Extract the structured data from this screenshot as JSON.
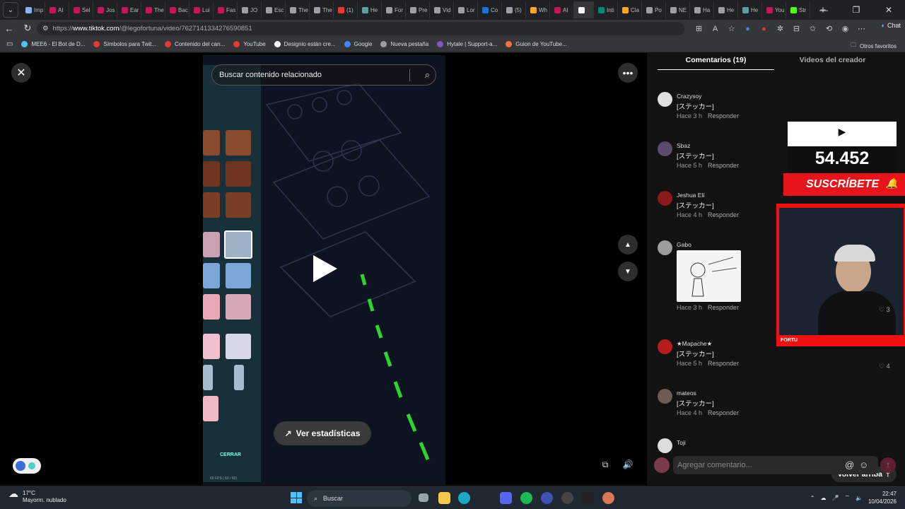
{
  "browser": {
    "tabs": [
      {
        "label": "Imp",
        "color": "#8ab4f8"
      },
      {
        "label": "AI",
        "color": "#c2185b"
      },
      {
        "label": "Sel",
        "color": "#c2185b"
      },
      {
        "label": "Jos",
        "color": "#c2185b"
      },
      {
        "label": "Ear",
        "color": "#c2185b"
      },
      {
        "label": "The",
        "color": "#c2185b"
      },
      {
        "label": "Bac",
        "color": "#c2185b"
      },
      {
        "label": "Lui",
        "color": "#c2185b"
      },
      {
        "label": "Fas",
        "color": "#c2185b"
      },
      {
        "label": "JO",
        "color": "#9aa0a6"
      },
      {
        "label": "Esc",
        "color": "#9aa0a6"
      },
      {
        "label": "The",
        "color": "#9aa0a6"
      },
      {
        "label": "The",
        "color": "#9aa0a6"
      },
      {
        "label": "(1)",
        "color": "#e53935"
      },
      {
        "label": "He",
        "color": "#5f9ea0"
      },
      {
        "label": "For",
        "color": "#9aa0a6"
      },
      {
        "label": "Pre",
        "color": "#9aa0a6"
      },
      {
        "label": "Vid",
        "color": "#9aa0a6"
      },
      {
        "label": "Lor",
        "color": "#9aa0a6"
      },
      {
        "label": "Co",
        "color": "#1976d2"
      },
      {
        "label": "(5)",
        "color": "#9aa0a6"
      },
      {
        "label": "Wh",
        "color": "#f9a825"
      },
      {
        "label": "AI",
        "color": "#c2185b"
      },
      {
        "label": "",
        "color": "#ffffff"
      },
      {
        "label": "Inti",
        "color": "#00897b"
      },
      {
        "label": "Cla",
        "color": "#f9a825"
      },
      {
        "label": "Po",
        "color": "#9aa0a6"
      },
      {
        "label": "NE",
        "color": "#9aa0a6"
      },
      {
        "label": "Ha",
        "color": "#9aa0a6"
      },
      {
        "label": "He",
        "color": "#9aa0a6"
      },
      {
        "label": "He",
        "color": "#5f9ea0"
      },
      {
        "label": "You",
        "color": "#c2185b"
      },
      {
        "label": "Str",
        "color": "#53fc18"
      }
    ],
    "new_tab": "+",
    "url_prefix": "https://",
    "url_host": "www.tiktok.com",
    "url_path": "/@legofortuna/video/7627141334276590851",
    "chat_label": "Chat",
    "bookmarks": [
      {
        "label": "MEE6 - El Bot de D...",
        "color": "#4fc3f7"
      },
      {
        "label": "Símbolos para Twit...",
        "color": "#e53935"
      },
      {
        "label": "Contenido del can...",
        "color": "#e53935"
      },
      {
        "label": "YouTube",
        "color": "#e53935"
      },
      {
        "label": "Designio están cre...",
        "color": "#ffffff"
      },
      {
        "label": "Google",
        "color": "#4285f4"
      },
      {
        "label": "Nueva pestaña",
        "color": "#9aa0a6"
      },
      {
        "label": "Hytale | Support-a...",
        "color": "#7e57c2"
      },
      {
        "label": "Guion de YouTube...",
        "color": "#ff7043"
      }
    ],
    "other_bookmarks": "Otros favoritos"
  },
  "video": {
    "search_placeholder": "Buscar contenido relacionado",
    "stats_label": "Ver estadísticas",
    "cerrar": "CERRAR",
    "fps": "60 FPS ( 60 / 60)"
  },
  "comments_panel": {
    "tab_comments": "Comentarios (19)",
    "tab_creator": "Videos del creador",
    "reply_label": "Responder",
    "comments": [
      {
        "name": "Crazysoy",
        "text": "[ステッカー]",
        "time": "Hace 3 h",
        "avatar": "#e0e0e0"
      },
      {
        "name": "Sbaz",
        "text": "[ステッカー]",
        "time": "Hace 5 h",
        "avatar": "#5b4a6b"
      },
      {
        "name": "Jeshua Elí",
        "text": "[ステッカー]",
        "time": "Hace 4 h",
        "avatar": "#8b1a1a"
      },
      {
        "name": "Gabo",
        "text": "",
        "time": "Hace 3 h",
        "avatar": "#9e9e9e",
        "likes": "3"
      },
      {
        "name": "★Mapache★",
        "text": "[ステッカー]",
        "time": "Hace 5 h",
        "avatar": "#b71c1c",
        "likes": "4"
      },
      {
        "name": "mateos",
        "text": "[ステッカー]",
        "time": "Hace 4 h",
        "avatar": "#6d5c4f"
      },
      {
        "name": "Toji",
        "text": "",
        "time": "",
        "avatar": "#ddd"
      }
    ],
    "back_to_top": "Volver arriba",
    "comment_placeholder": "Agregar comentario..."
  },
  "stream_overlay": {
    "subscriber_count": "54.452",
    "subscribe": "SUSCRÍBETE",
    "name": "FORTU"
  },
  "taskbar": {
    "temp": "17°C",
    "weather": "Mayorm. nublado",
    "search": "Buscar",
    "time": "22:47",
    "date": "10/04/2026"
  }
}
